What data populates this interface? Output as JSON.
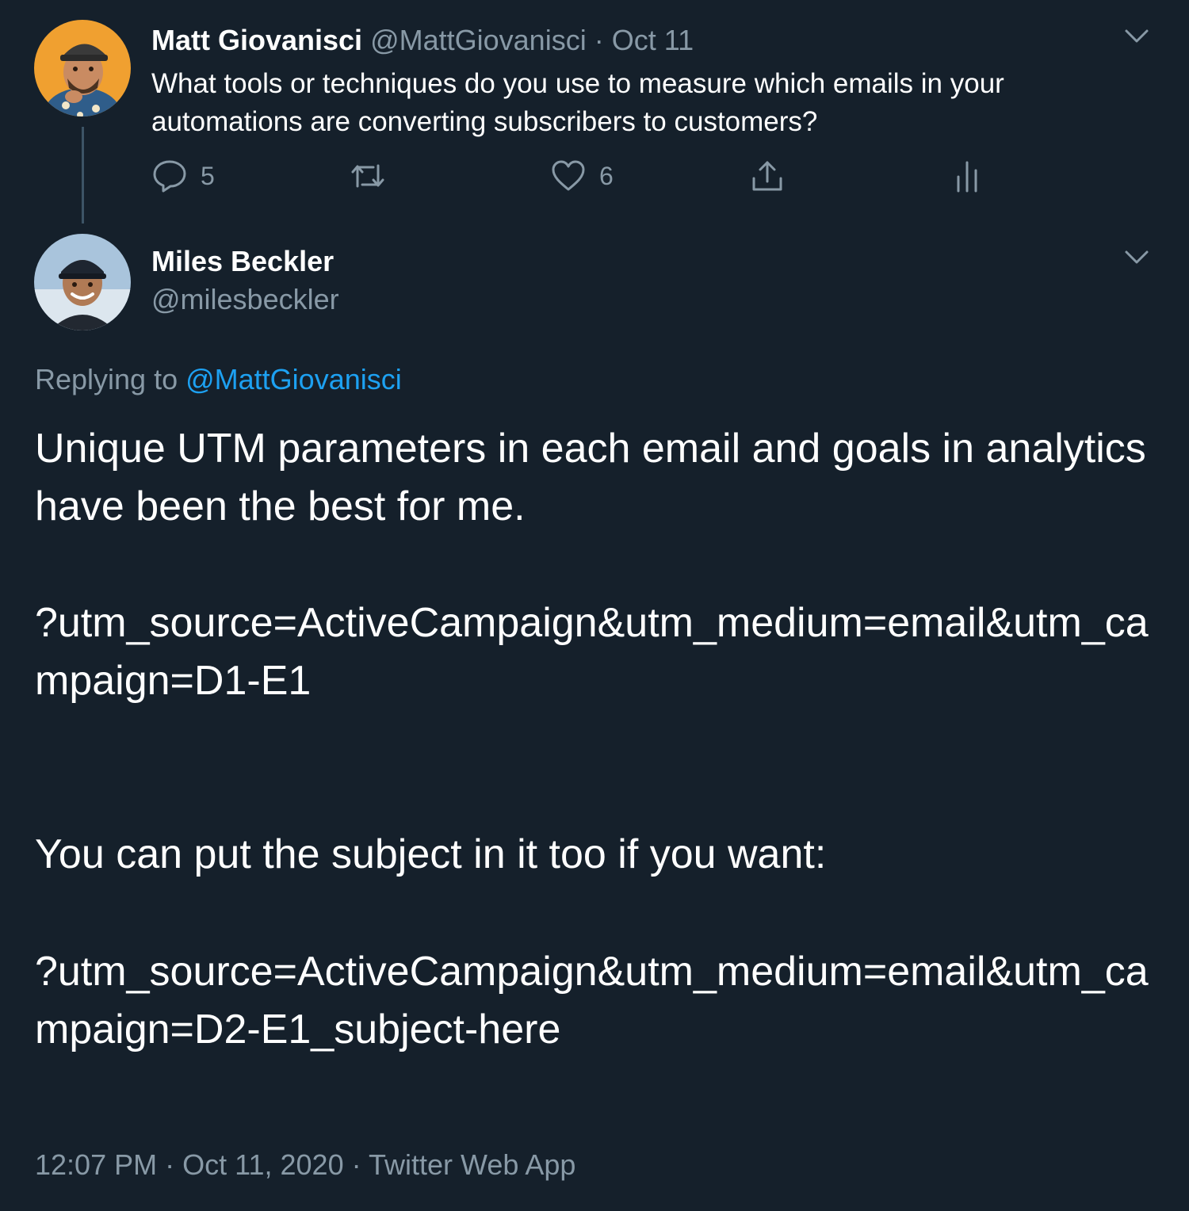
{
  "colors": {
    "background": "#15202b",
    "text_primary": "#ffffff",
    "text_secondary": "#8899a6",
    "link": "#1da1f2"
  },
  "parent_tweet": {
    "author_name": "Matt Giovanisci",
    "author_handle": "@MattGiovanisci",
    "separator": "·",
    "date": "Oct 11",
    "text": "What tools or techniques do you use to measure which emails in your automations are converting subscribers to customers?",
    "actions": {
      "reply": {
        "icon": "reply-icon",
        "count": "5"
      },
      "retweet": {
        "icon": "retweet-icon"
      },
      "like": {
        "icon": "heart-icon",
        "count": "6"
      },
      "share": {
        "icon": "share-icon"
      },
      "analytics": {
        "icon": "analytics-icon"
      }
    },
    "menu_icon": "chevron-down-icon"
  },
  "reply_tweet": {
    "author_name": "Miles Beckler",
    "author_handle": "@milesbeckler",
    "replying_to_label": "Replying to",
    "replying_to_handle": "@MattGiovanisci",
    "paragraphs": [
      "Unique UTM parameters in each email and goals in analytics have been the best for me.",
      "?utm_source=ActiveCampaign&utm_medium=email&utm_campaign=D1-E1",
      "You can put the subject in it too if you want:",
      "?utm_source=ActiveCampaign&utm_medium=email&utm_campaign=D2-E1_subject-here"
    ],
    "time": "12:07 PM",
    "separator": "·",
    "full_date": "Oct 11, 2020",
    "client": "Twitter Web App",
    "menu_icon": "chevron-down-icon"
  }
}
